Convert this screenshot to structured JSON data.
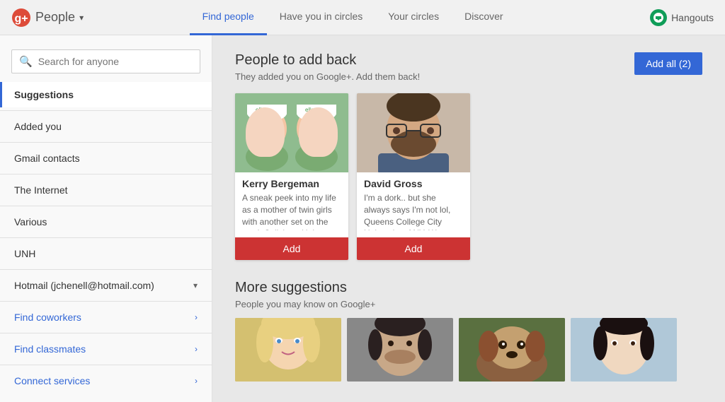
{
  "header": {
    "app_title": "People",
    "tabs": [
      {
        "label": "Find people",
        "active": true
      },
      {
        "label": "Have you in circles",
        "active": false
      },
      {
        "label": "Your circles",
        "active": false
      },
      {
        "label": "Discover",
        "active": false
      }
    ],
    "hangouts_label": "Hangouts"
  },
  "sidebar": {
    "search_placeholder": "Search for anyone",
    "items": [
      {
        "label": "Suggestions",
        "active": true,
        "type": "normal"
      },
      {
        "label": "Added you",
        "active": false,
        "type": "normal"
      },
      {
        "label": "Gmail contacts",
        "active": false,
        "type": "normal"
      },
      {
        "label": "The Internet",
        "active": false,
        "type": "normal"
      },
      {
        "label": "Various",
        "active": false,
        "type": "normal"
      },
      {
        "label": "UNH",
        "active": false,
        "type": "normal"
      },
      {
        "label": "Hotmail (jchenell@hotmail.com)",
        "active": false,
        "type": "hotmail"
      }
    ],
    "links": [
      {
        "label": "Find coworkers",
        "type": "link"
      },
      {
        "label": "Find classmates",
        "type": "link"
      },
      {
        "label": "Connect services",
        "type": "link"
      }
    ]
  },
  "main": {
    "add_back_title": "People to add back",
    "add_back_subtitle": "They added you on Google+. Add them back!",
    "add_all_label": "Add all (2)",
    "people_cards": [
      {
        "name": "Kerry Bergeman",
        "description": "A sneak peek into my life as a mother of twin girls with another set on the way!, Salisbury Univers…",
        "add_label": "Add",
        "photo_type": "kerry"
      },
      {
        "name": "David Gross",
        "description": "I'm a dork.. but she always says I'm not lol, Queens College City University of NY, West …",
        "add_label": "Add",
        "photo_type": "david"
      }
    ],
    "more_title": "More suggestions",
    "more_subtitle": "People you may know on Google+"
  }
}
